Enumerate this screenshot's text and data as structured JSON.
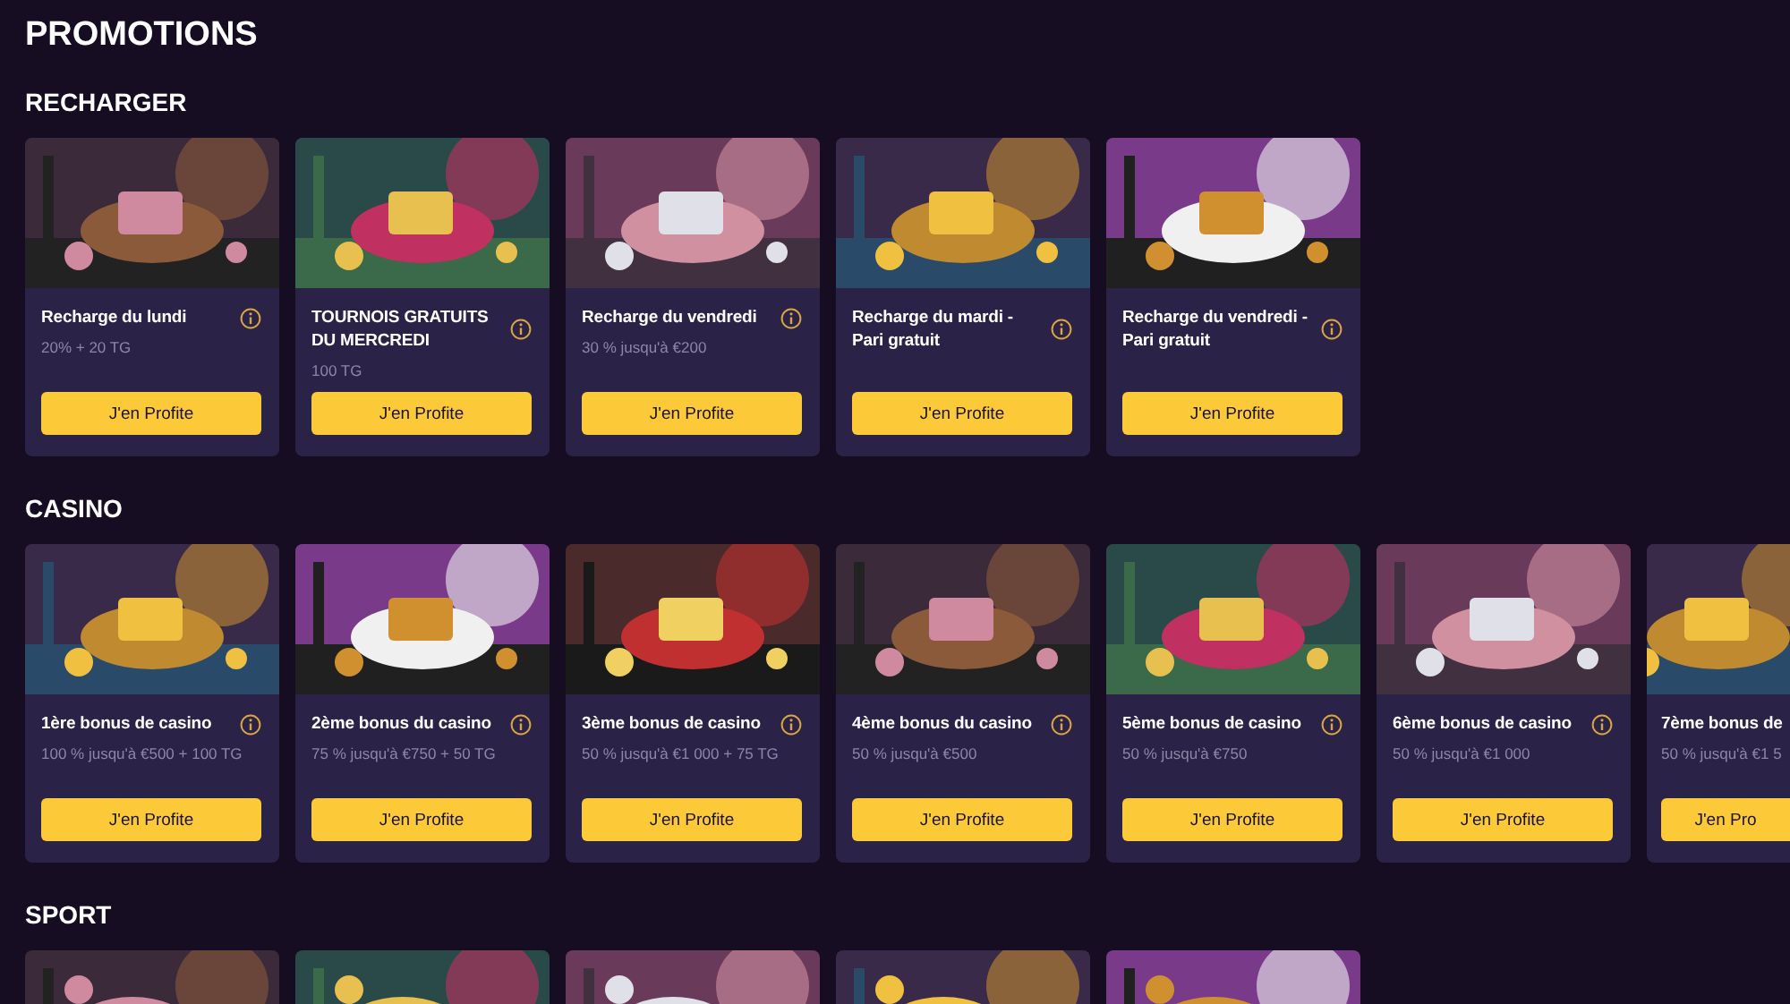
{
  "page_title": "PROMOTIONS",
  "sections": [
    {
      "title": "RECHARGER",
      "cards": [
        {
          "title": "Recharge du lundi",
          "subtitle": "20% + 20 TG",
          "button": "J'en Profite"
        },
        {
          "title": "TOURNOIS GRATUITS DU MERCREDI",
          "subtitle": "100 TG",
          "button": "J'en Profite"
        },
        {
          "title": "Recharge du vendredi",
          "subtitle": "30 % jusqu'à €200",
          "button": "J'en Profite"
        },
        {
          "title": "Recharge du mardi - Pari gratuit",
          "button": "J'en Profite"
        },
        {
          "title": "Recharge du vendredi - Pari gratuit",
          "button": "J'en Profite"
        }
      ]
    },
    {
      "title": "CASINO",
      "cards": [
        {
          "title": "1ère bonus de casino",
          "subtitle": "100 % jusqu'à €500 + 100 TG",
          "button": "J'en Profite"
        },
        {
          "title": "2ème bonus du casino",
          "subtitle": "75 % jusqu'à €750 + 50 TG",
          "button": "J'en Profite"
        },
        {
          "title": "3ème bonus de casino",
          "subtitle": "50 % jusqu'à €1 000 + 75 TG",
          "button": "J'en Profite"
        },
        {
          "title": "4ème bonus du casino",
          "subtitle": "50 % jusqu'à €500",
          "button": "J'en Profite"
        },
        {
          "title": "5ème bonus de casino",
          "subtitle": "50 % jusqu'à €750",
          "button": "J'en Profite"
        },
        {
          "title": "6ème bonus de casino",
          "subtitle": "50 % jusqu'à €1 000",
          "button": "J'en Profite"
        },
        {
          "title": "7ème bonus de",
          "subtitle": "50 % jusqu'à €1 5",
          "button": "J'en Pro",
          "cut": true
        }
      ]
    },
    {
      "title": "SPORT"
    }
  ]
}
